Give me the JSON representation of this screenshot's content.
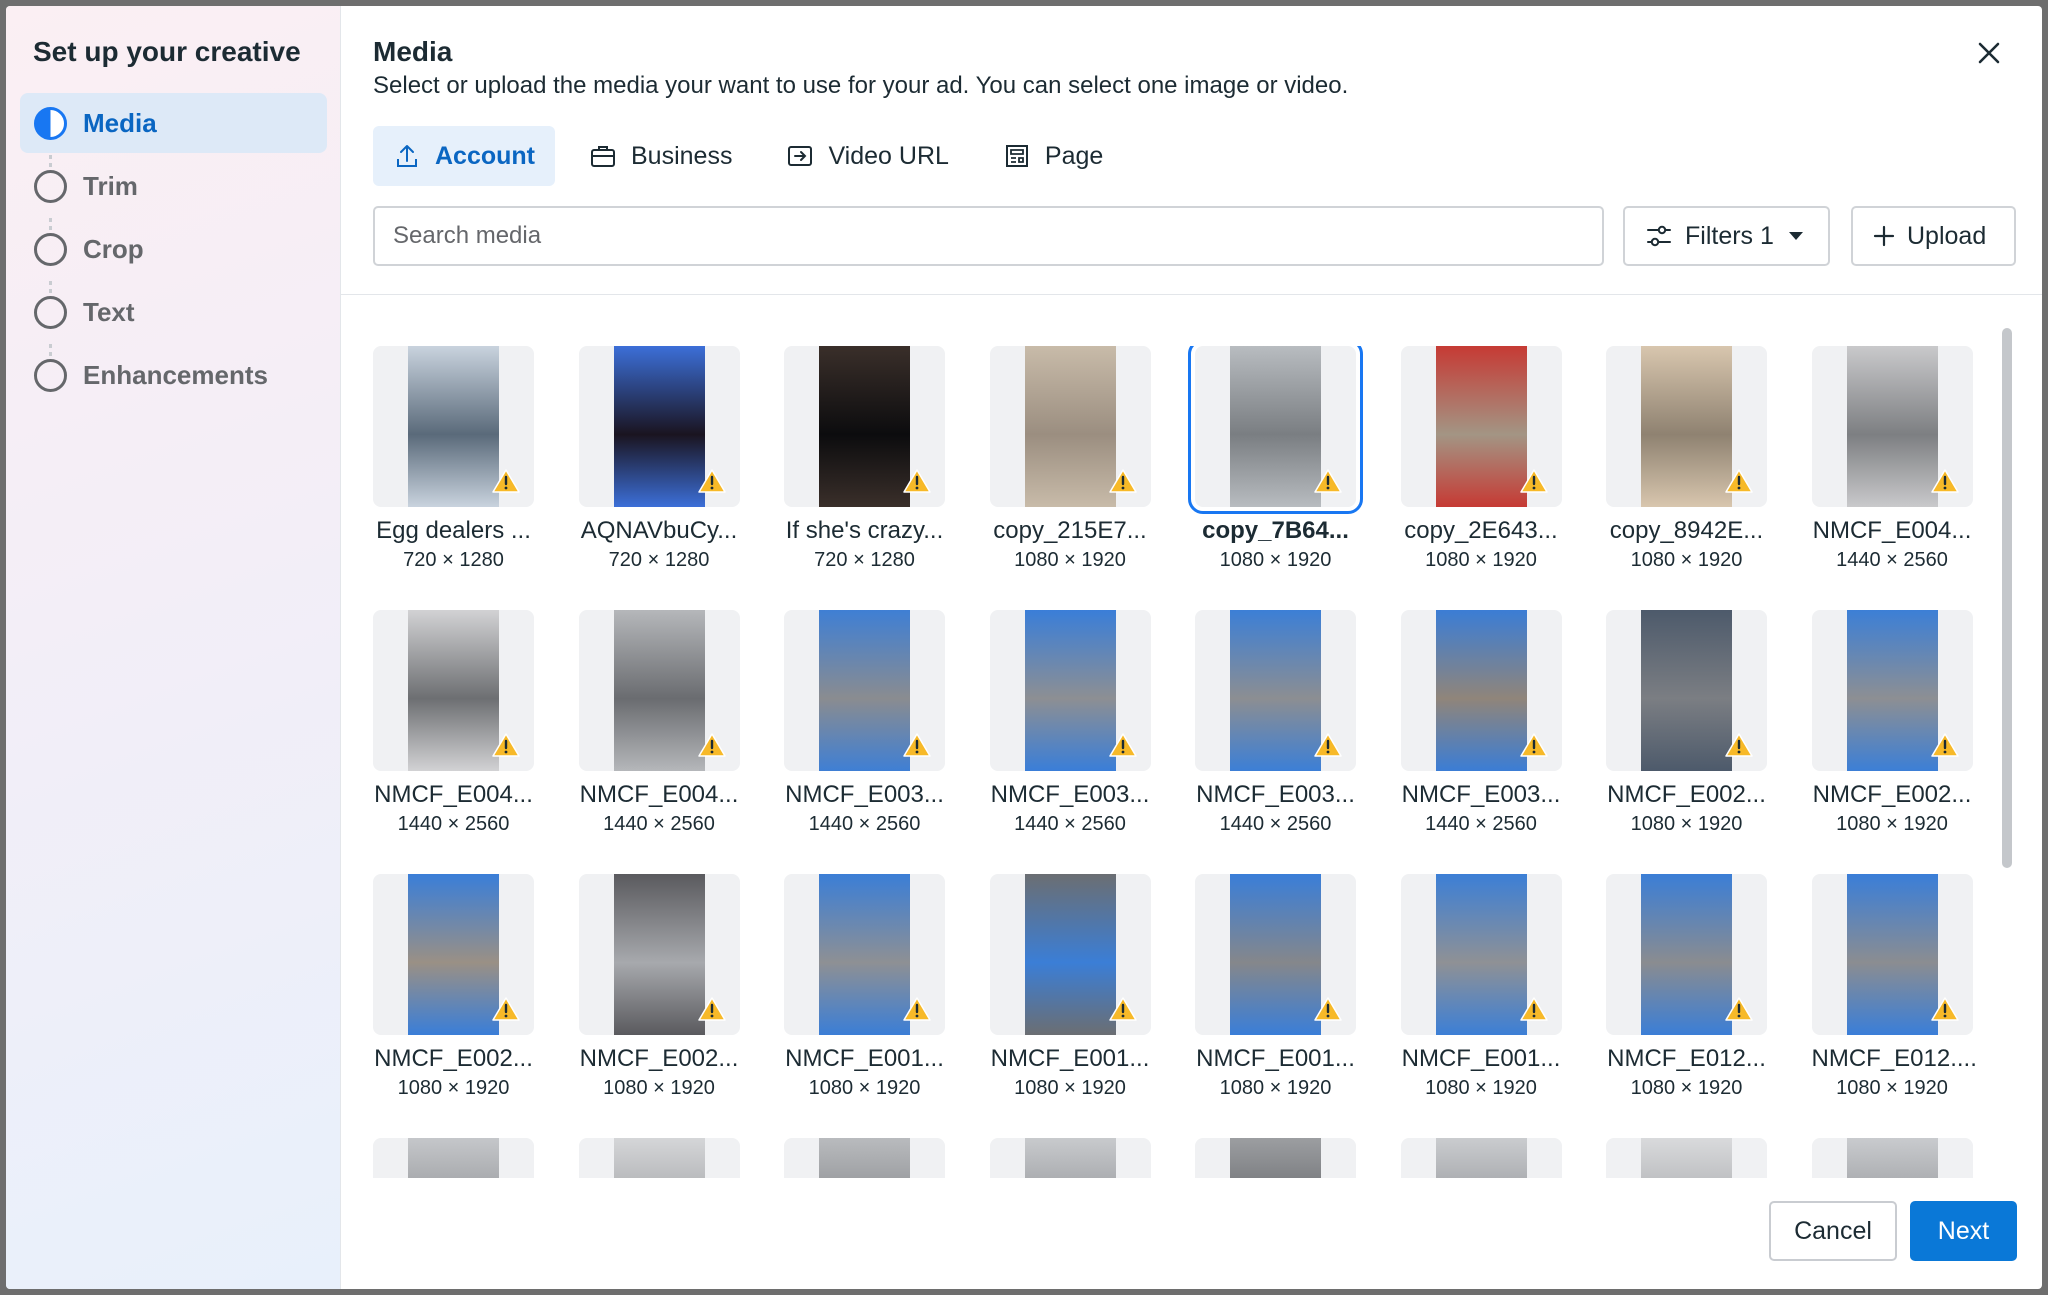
{
  "sidebar": {
    "title": "Set up your creative",
    "steps": [
      {
        "label": "Media",
        "active": true
      },
      {
        "label": "Trim",
        "active": false
      },
      {
        "label": "Crop",
        "active": false
      },
      {
        "label": "Text",
        "active": false
      },
      {
        "label": "Enhancements",
        "active": false
      }
    ]
  },
  "header": {
    "title": "Media",
    "subtitle": "Select or upload the media your want to use for your ad. You can select one image or video."
  },
  "tabs": [
    {
      "label": "Account",
      "icon": "upload-icon",
      "active": true
    },
    {
      "label": "Business",
      "icon": "briefcase-icon",
      "active": false
    },
    {
      "label": "Video URL",
      "icon": "link-out-icon",
      "active": false
    },
    {
      "label": "Page",
      "icon": "page-icon",
      "active": false
    }
  ],
  "search": {
    "placeholder": "Search media",
    "value": ""
  },
  "filters": {
    "label": "Filters 1"
  },
  "upload": {
    "label": "Upload"
  },
  "media": [
    {
      "name": "Egg dealers ...",
      "dims": "720 × 1280",
      "colors": [
        "#5a6a7a",
        "#c9d3de"
      ],
      "selected": false,
      "warning": true
    },
    {
      "name": "AQNAVbuCy...",
      "dims": "720 × 1280",
      "colors": [
        "#1a1420",
        "#3c6fd8"
      ],
      "selected": false,
      "warning": true
    },
    {
      "name": "If she's crazy...",
      "dims": "720 × 1280",
      "colors": [
        "#0c0c0e",
        "#3a2f2a"
      ],
      "selected": false,
      "warning": true
    },
    {
      "name": "copy_215E7...",
      "dims": "1080 × 1920",
      "colors": [
        "#9b8e80",
        "#c8bba9"
      ],
      "selected": false,
      "warning": true
    },
    {
      "name": "copy_7B64...",
      "dims": "1080 × 1920",
      "colors": [
        "#7a7e82",
        "#b8bcc0"
      ],
      "selected": true,
      "warning": true
    },
    {
      "name": "copy_2E643...",
      "dims": "1080 × 1920",
      "colors": [
        "#a39584",
        "#c63a34"
      ],
      "selected": false,
      "warning": true
    },
    {
      "name": "copy_8942E...",
      "dims": "1080 × 1920",
      "colors": [
        "#8f8271",
        "#d8c6ae"
      ],
      "selected": false,
      "warning": true
    },
    {
      "name": "NMCF_E004...",
      "dims": "1440 × 2560",
      "colors": [
        "#7d7f82",
        "#c9c9cb"
      ],
      "selected": false,
      "warning": true
    },
    {
      "name": "NMCF_E004...",
      "dims": "1440 × 2560",
      "colors": [
        "#6d6f72",
        "#d2d2d4"
      ],
      "selected": false,
      "warning": true
    },
    {
      "name": "NMCF_E004...",
      "dims": "1440 × 2560",
      "colors": [
        "#6a6c70",
        "#b5b7ba"
      ],
      "selected": false,
      "warning": true
    },
    {
      "name": "NMCF_E003...",
      "dims": "1440 × 2560",
      "colors": [
        "#8a8c90",
        "#3f7fd4"
      ],
      "selected": false,
      "warning": true
    },
    {
      "name": "NMCF_E003...",
      "dims": "1440 × 2560",
      "colors": [
        "#8d8f93",
        "#3a7ed8"
      ],
      "selected": false,
      "warning": true
    },
    {
      "name": "NMCF_E003...",
      "dims": "1440 × 2560",
      "colors": [
        "#8c8e92",
        "#3c7fd6"
      ],
      "selected": false,
      "warning": true
    },
    {
      "name": "NMCF_E003...",
      "dims": "1440 × 2560",
      "colors": [
        "#90857a",
        "#3b7dd5"
      ],
      "selected": false,
      "warning": true
    },
    {
      "name": "NMCF_E002...",
      "dims": "1080 × 1920",
      "colors": [
        "#7b7e83",
        "#4d5a6b"
      ],
      "selected": false,
      "warning": true
    },
    {
      "name": "NMCF_E002...",
      "dims": "1080 × 1920",
      "colors": [
        "#8d8f93",
        "#3c7fd6"
      ],
      "selected": false,
      "warning": true
    },
    {
      "name": "NMCF_E002...",
      "dims": "1080 × 1920",
      "colors": [
        "#9a9085",
        "#3a7ed8"
      ],
      "selected": false,
      "warning": true
    },
    {
      "name": "NMCF_E002...",
      "dims": "1080 × 1920",
      "colors": [
        "#a7a9ad",
        "#5a5a5e"
      ],
      "selected": false,
      "warning": true
    },
    {
      "name": "NMCF_E001...",
      "dims": "1080 × 1920",
      "colors": [
        "#8e9094",
        "#3b7ed6"
      ],
      "selected": false,
      "warning": true
    },
    {
      "name": "NMCF_E001...",
      "dims": "1080 × 1920",
      "colors": [
        "#3b7ed6",
        "#6b6e72"
      ],
      "selected": false,
      "warning": true
    },
    {
      "name": "NMCF_E001...",
      "dims": "1080 × 1920",
      "colors": [
        "#85878b",
        "#3a7ed8"
      ],
      "selected": false,
      "warning": true
    },
    {
      "name": "NMCF_E001...",
      "dims": "1080 × 1920",
      "colors": [
        "#8f9195",
        "#3c7fd6"
      ],
      "selected": false,
      "warning": true
    },
    {
      "name": "NMCF_E012...",
      "dims": "1080 × 1920",
      "colors": [
        "#8a8c90",
        "#3b7ed6"
      ],
      "selected": false,
      "warning": true
    },
    {
      "name": "NMCF_E012....",
      "dims": "1080 × 1920",
      "colors": [
        "#8b8d91",
        "#3a7ed8"
      ],
      "selected": false,
      "warning": true
    },
    {
      "name": "",
      "dims": "",
      "colors": [
        "#8a8c90",
        "#c5c7ca"
      ],
      "selected": false,
      "warning": false
    },
    {
      "name": "",
      "dims": "",
      "colors": [
        "#9a9c9f",
        "#d5d6d8"
      ],
      "selected": false,
      "warning": false
    },
    {
      "name": "",
      "dims": "",
      "colors": [
        "#7f8185",
        "#b9bbbe"
      ],
      "selected": false,
      "warning": false
    },
    {
      "name": "",
      "dims": "",
      "colors": [
        "#8c8e92",
        "#c8cacd"
      ],
      "selected": false,
      "warning": false
    },
    {
      "name": "",
      "dims": "",
      "colors": [
        "#5e6064",
        "#9c9ea1"
      ],
      "selected": false,
      "warning": false
    },
    {
      "name": "",
      "dims": "",
      "colors": [
        "#8d8f93",
        "#cacccf"
      ],
      "selected": false,
      "warning": false
    },
    {
      "name": "",
      "dims": "",
      "colors": [
        "#a2a4a7",
        "#d9dadc"
      ],
      "selected": false,
      "warning": false
    },
    {
      "name": "",
      "dims": "",
      "colors": [
        "#8e9094",
        "#c9cbce"
      ],
      "selected": false,
      "warning": false
    }
  ],
  "footer": {
    "cancel_label": "Cancel",
    "next_label": "Next"
  },
  "colors": {
    "accent": "#1877f2",
    "primary_button": "#0a78d7",
    "warning": "#f7b928"
  }
}
